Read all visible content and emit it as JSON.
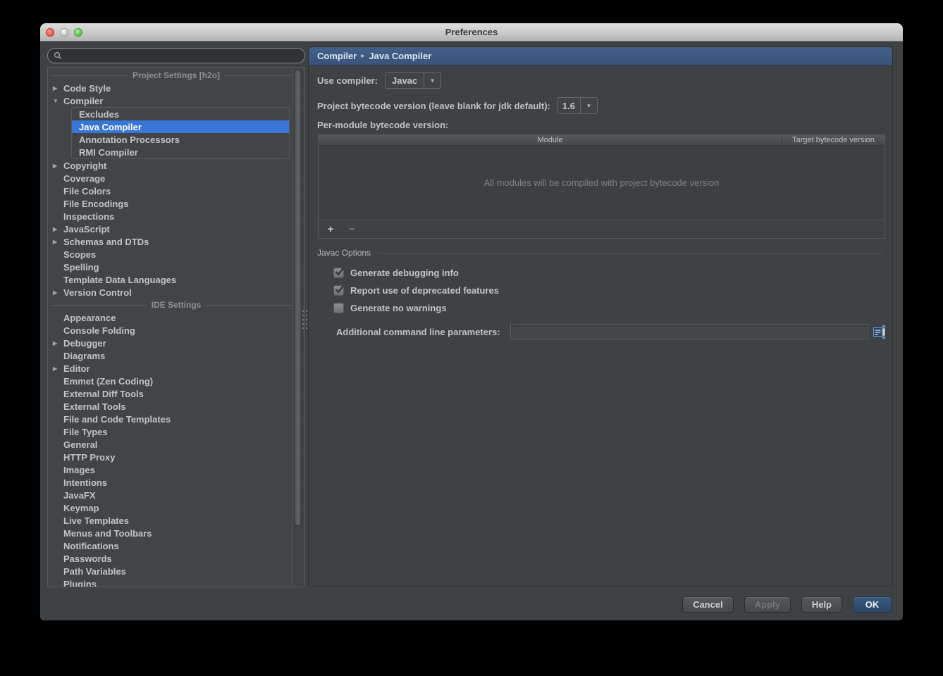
{
  "window": {
    "title": "Preferences"
  },
  "icons": {
    "tree_collapsed": "▶",
    "tree_expanded": "▼",
    "dropdown_arrow": "▼",
    "breadcrumb_sep": "▸"
  },
  "sidebar": {
    "search": {
      "value": "",
      "placeholder": ""
    },
    "tree": [
      {
        "type": "header",
        "label": "Project Settings [h2o]"
      },
      {
        "type": "item",
        "label": "Code Style",
        "state": "collapsed"
      },
      {
        "type": "item",
        "label": "Compiler",
        "state": "expanded"
      },
      {
        "type": "group",
        "items": [
          {
            "label": "Excludes"
          },
          {
            "label": "Java Compiler",
            "selected": true
          },
          {
            "label": "Annotation Processors"
          },
          {
            "label": "RMI Compiler"
          }
        ]
      },
      {
        "type": "item",
        "label": "Copyright",
        "state": "collapsed"
      },
      {
        "type": "item",
        "label": "Coverage"
      },
      {
        "type": "item",
        "label": "File Colors"
      },
      {
        "type": "item",
        "label": "File Encodings"
      },
      {
        "type": "item",
        "label": "Inspections"
      },
      {
        "type": "item",
        "label": "JavaScript",
        "state": "collapsed"
      },
      {
        "type": "item",
        "label": "Schemas and DTDs",
        "state": "collapsed"
      },
      {
        "type": "item",
        "label": "Scopes"
      },
      {
        "type": "item",
        "label": "Spelling"
      },
      {
        "type": "item",
        "label": "Template Data Languages"
      },
      {
        "type": "item",
        "label": "Version Control",
        "state": "collapsed"
      },
      {
        "type": "header",
        "label": "IDE Settings"
      },
      {
        "type": "item",
        "label": "Appearance"
      },
      {
        "type": "item",
        "label": "Console Folding"
      },
      {
        "type": "item",
        "label": "Debugger",
        "state": "collapsed"
      },
      {
        "type": "item",
        "label": "Diagrams"
      },
      {
        "type": "item",
        "label": "Editor",
        "state": "collapsed"
      },
      {
        "type": "item",
        "label": "Emmet (Zen Coding)"
      },
      {
        "type": "item",
        "label": "External Diff Tools"
      },
      {
        "type": "item",
        "label": "External Tools"
      },
      {
        "type": "item",
        "label": "File and Code Templates"
      },
      {
        "type": "item",
        "label": "File Types"
      },
      {
        "type": "item",
        "label": "General"
      },
      {
        "type": "item",
        "label": "HTTP Proxy"
      },
      {
        "type": "item",
        "label": "Images"
      },
      {
        "type": "item",
        "label": "Intentions"
      },
      {
        "type": "item",
        "label": "JavaFX"
      },
      {
        "type": "item",
        "label": "Keymap"
      },
      {
        "type": "item",
        "label": "Live Templates"
      },
      {
        "type": "item",
        "label": "Menus and Toolbars"
      },
      {
        "type": "item",
        "label": "Notifications"
      },
      {
        "type": "item",
        "label": "Passwords"
      },
      {
        "type": "item",
        "label": "Path Variables"
      },
      {
        "type": "item",
        "label": "Plugins"
      }
    ]
  },
  "main": {
    "breadcrumb": {
      "parts": [
        "Compiler",
        "Java Compiler"
      ],
      "separator": "▸"
    },
    "use_compiler": {
      "label": "Use compiler:",
      "value": "Javac"
    },
    "bytecode": {
      "label": "Project bytecode version (leave blank for jdk default):",
      "value": "1.6"
    },
    "per_module": {
      "label": "Per-module bytecode version:",
      "columns": [
        "Module",
        "Target bytecode version"
      ],
      "empty_text": "All modules will be compiled with project bytecode version",
      "add_label": "+",
      "remove_label": "−"
    },
    "javac_options": {
      "title": "Javac Options",
      "checkboxes": [
        {
          "label": "Generate debugging info",
          "checked": true
        },
        {
          "label": "Report use of deprecated features",
          "checked": true
        },
        {
          "label": "Generate no warnings",
          "checked": false
        }
      ],
      "params": {
        "label": "Additional command line parameters:",
        "value": ""
      }
    }
  },
  "footer": {
    "cancel": "Cancel",
    "apply": "Apply",
    "help": "Help",
    "ok": "OK"
  },
  "colors": {
    "selection_blue": "#3875d6",
    "header_blue": "#3d5878",
    "ok_blue": "#31506f",
    "panel_bg": "#3e4244"
  }
}
